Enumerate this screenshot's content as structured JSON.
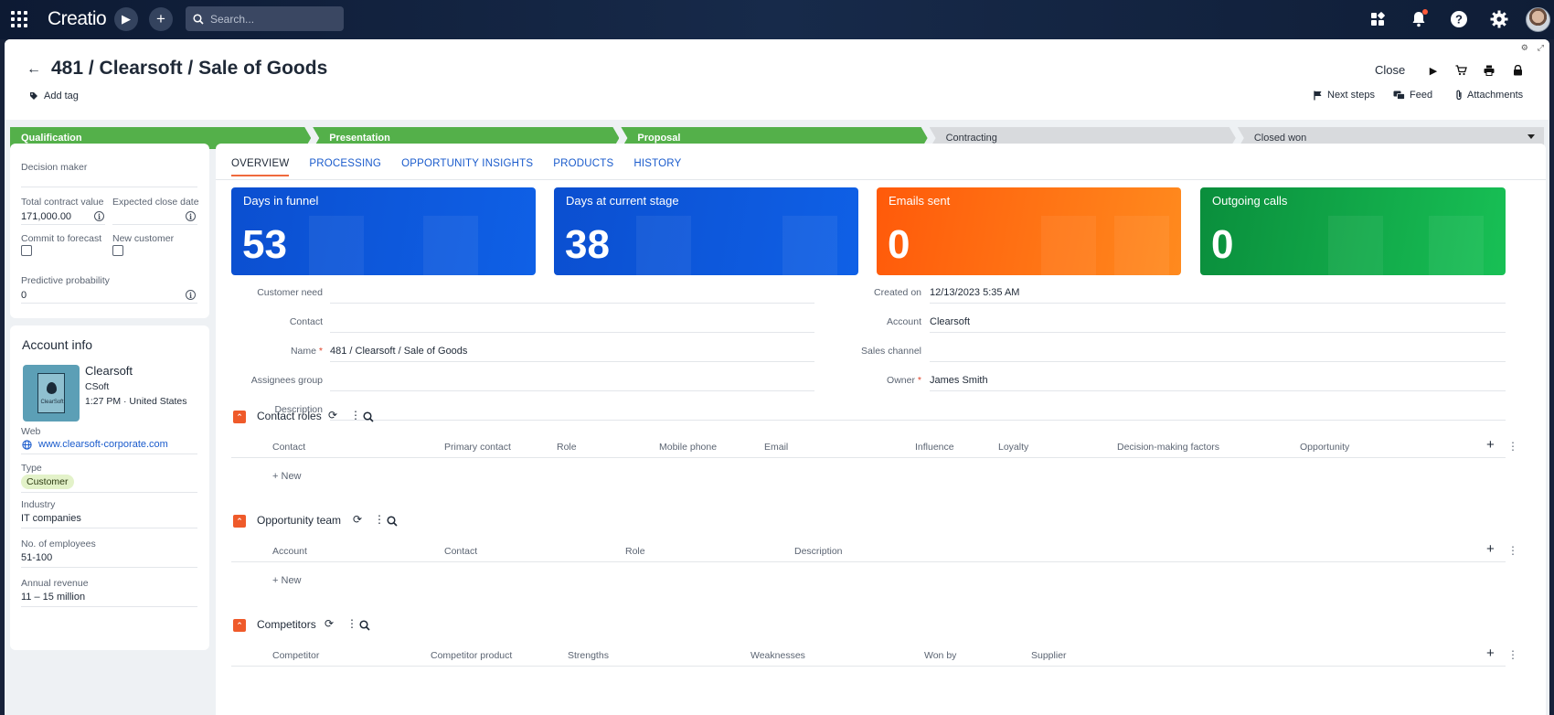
{
  "topbar": {
    "logo": "Creatio",
    "search_placeholder": "Search..."
  },
  "header": {
    "title": "481 / Clearsoft / Sale of Goods",
    "add_tag": "Add tag",
    "close": "Close",
    "next_steps": "Next steps",
    "feed": "Feed",
    "attachments": "Attachments"
  },
  "stages": [
    {
      "label": "Qualification",
      "done": true
    },
    {
      "label": "Presentation",
      "done": true
    },
    {
      "label": "Proposal",
      "done": true
    },
    {
      "label": "Contracting",
      "done": false
    },
    {
      "label": "Closed won",
      "done": false
    }
  ],
  "left": {
    "decision_maker_label": "Decision maker",
    "total_contract_label": "Total contract value",
    "total_contract_value": "171,000.00",
    "expected_close_label": "Expected close date",
    "commit_label": "Commit to forecast",
    "new_customer_label": "New customer",
    "predictive_label": "Predictive probability",
    "predictive_value": "0"
  },
  "account": {
    "section_title": "Account info",
    "name": "Clearsoft",
    "logo_text": "ClearSoft",
    "alt_name": "CSoft",
    "time_country": "1:27 PM · United States",
    "web_label": "Web",
    "web_value": "www.clearsoft-corporate.com",
    "type_label": "Type",
    "type_value": "Customer",
    "industry_label": "Industry",
    "industry_value": "IT companies",
    "employees_label": "No. of employees",
    "employees_value": "51-100",
    "revenue_label": "Annual revenue",
    "revenue_value": "11 – 15 million"
  },
  "tabs": [
    "OVERVIEW",
    "PROCESSING",
    "OPPORTUNITY INSIGHTS",
    "PRODUCTS",
    "HISTORY"
  ],
  "kpis": [
    {
      "label": "Days in funnel",
      "value": "53",
      "color": "#0c56d8"
    },
    {
      "label": "Days at current stage",
      "value": "38",
      "color": "#0c56d8"
    },
    {
      "label": "Emails sent",
      "value": "0",
      "color": "#ff6a12"
    },
    {
      "label": "Outgoing calls",
      "value": "0",
      "color": "#13a84a"
    }
  ],
  "form": {
    "customer_need": "Customer need",
    "contact": "Contact",
    "name_label": "Name",
    "name_value": "481 / Clearsoft / Sale of Goods",
    "assignees": "Assignees group",
    "description": "Description",
    "created_label": "Created on",
    "created_value": "12/13/2023 5:35 AM",
    "account_label": "Account",
    "account_value": "Clearsoft",
    "sales_channel": "Sales channel",
    "owner_label": "Owner",
    "owner_value": "James Smith"
  },
  "sections": {
    "contact_roles": {
      "title": "Contact roles",
      "columns": [
        "Contact",
        "Primary contact",
        "Role",
        "Mobile phone",
        "Email",
        "Influence",
        "Loyalty",
        "Decision-making factors",
        "Opportunity"
      ],
      "new": "New"
    },
    "team": {
      "title": "Opportunity team",
      "columns": [
        "Account",
        "Contact",
        "Role",
        "Description"
      ],
      "new": "New"
    },
    "competitors": {
      "title": "Competitors",
      "columns": [
        "Competitor",
        "Competitor product",
        "Strengths",
        "Weaknesses",
        "Won by",
        "Supplier"
      ]
    }
  }
}
